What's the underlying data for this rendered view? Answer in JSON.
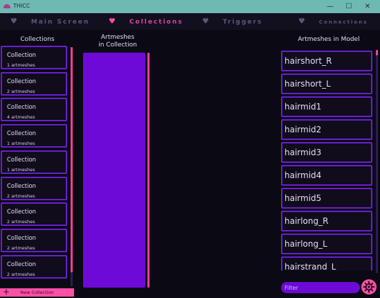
{
  "window": {
    "title": "THICC",
    "minimize": "—",
    "maximize": "☐",
    "close": "✕"
  },
  "nav": {
    "tabs": [
      {
        "label": "Main Screen",
        "active": false
      },
      {
        "label": "Collections",
        "active": true
      },
      {
        "label": "Triggers",
        "active": false
      },
      {
        "label": "Connections",
        "active": false
      }
    ],
    "heart_glyph": "♥"
  },
  "collections": {
    "title": "Collections",
    "items": [
      {
        "name": "Collection",
        "count": "1 artmeshes"
      },
      {
        "name": "Collection",
        "count": "2 artmeshes"
      },
      {
        "name": "Collection",
        "count": "4 artmeshes"
      },
      {
        "name": "Collection",
        "count": "1 artmeshes"
      },
      {
        "name": "Collection",
        "count": "1 artmeshes"
      },
      {
        "name": "Collection",
        "count": "2 artmeshes"
      },
      {
        "name": "Collection",
        "count": "2 artmeshes"
      },
      {
        "name": "Collection",
        "count": "2 artmeshes"
      },
      {
        "name": "Collection",
        "count": "2 artmeshes"
      }
    ],
    "new_button": {
      "icon": "+",
      "label": "New Collection"
    }
  },
  "artmeshes_in_collection": {
    "title_line1": "Artmeshes",
    "title_line2": "in Collection"
  },
  "artmeshes_in_model": {
    "title": "Artmeshes in Model",
    "items": [
      "hairshort_R",
      "hairshort_L",
      "hairmid1",
      "hairmid2",
      "hairmid3",
      "hairmid4",
      "hairmid5",
      "hairlong_R",
      "hairlong_L",
      "hairstrand_L"
    ],
    "filter_placeholder": "Filter"
  },
  "colors": {
    "accent_pink": "#ff4fa6",
    "accent_purple": "#6d0ad6",
    "titlebar": "#6fb9b3",
    "background": "#0b0914"
  },
  "icons": {
    "app": "app-logo-icon",
    "heart": "heart-icon",
    "plus": "plus-icon",
    "settings": "gear-icon"
  }
}
